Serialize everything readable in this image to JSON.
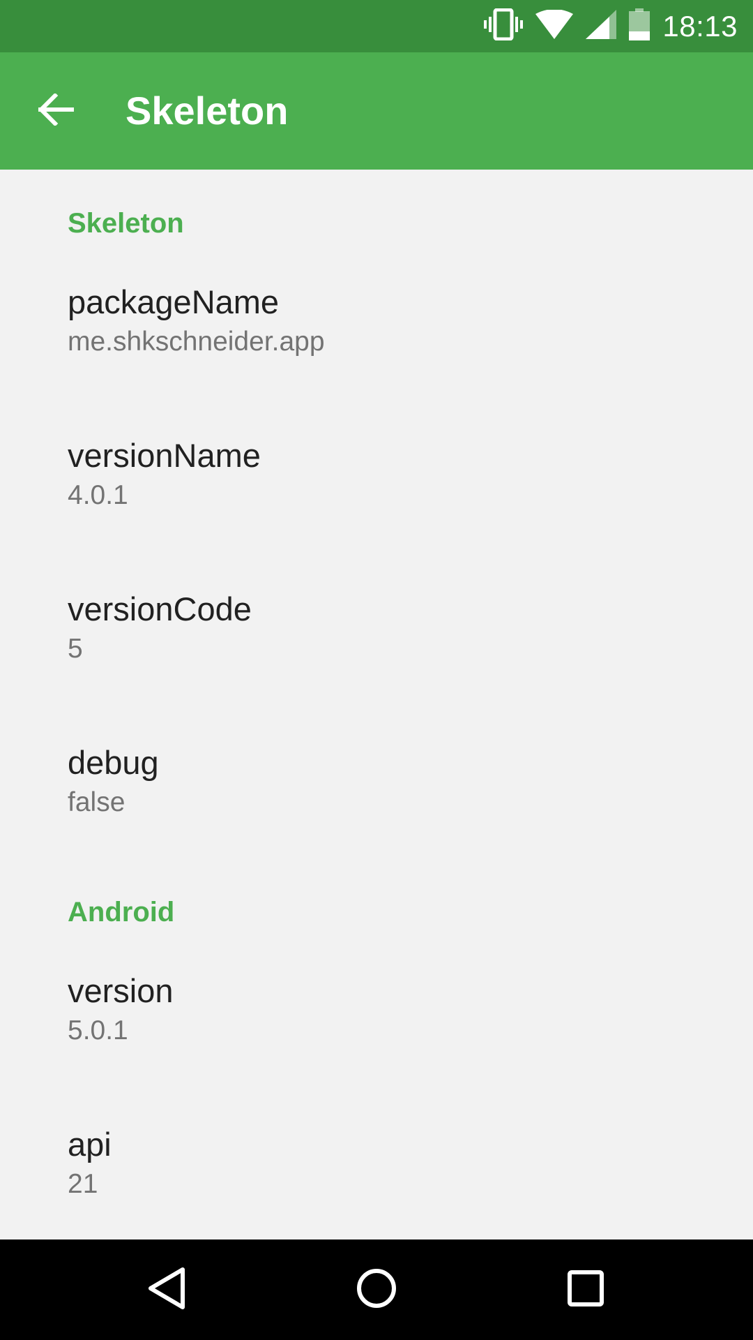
{
  "status_bar": {
    "time": "18:13",
    "icons": [
      "vibrate-icon",
      "wifi-icon",
      "cell-signal-icon",
      "battery-icon"
    ]
  },
  "toolbar": {
    "back_icon": "arrow-back-icon",
    "title": "Skeleton"
  },
  "sections": [
    {
      "header": "Skeleton",
      "items": [
        {
          "title": "packageName",
          "summary": "me.shkschneider.app"
        },
        {
          "title": "versionName",
          "summary": "4.0.1"
        },
        {
          "title": "versionCode",
          "summary": "5"
        },
        {
          "title": "debug",
          "summary": "false"
        }
      ]
    },
    {
      "header": "Android",
      "items": [
        {
          "title": "version",
          "summary": "5.0.1"
        },
        {
          "title": "api",
          "summary": "21"
        }
      ]
    }
  ],
  "nav_bar": {
    "icons": [
      "nav-back-icon",
      "nav-home-icon",
      "nav-recents-icon"
    ]
  },
  "colors": {
    "status_bar": "#388e3c",
    "toolbar": "#4caf50",
    "accent": "#4caf50",
    "background": "#f2f2f2",
    "title_text": "#212121",
    "summary_text": "#737373"
  }
}
